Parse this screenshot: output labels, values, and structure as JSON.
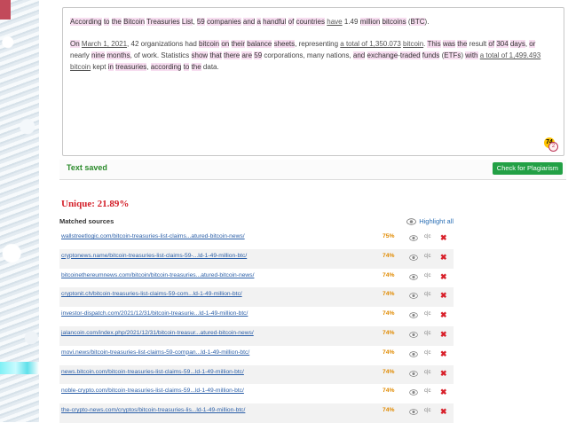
{
  "editor": {
    "paragraph1": [
      {
        "t": "According",
        "c": "hl"
      },
      {
        "t": " "
      },
      {
        "t": "to",
        "c": "hl"
      },
      {
        "t": " "
      },
      {
        "t": "the",
        "c": "hl"
      },
      {
        "t": " "
      },
      {
        "t": "Bitcoin",
        "c": "hl"
      },
      {
        "t": " "
      },
      {
        "t": "Treasuries",
        "c": "hl"
      },
      {
        "t": " "
      },
      {
        "t": "List",
        "c": "hl"
      },
      {
        "t": ", "
      },
      {
        "t": "59",
        "c": "hl"
      },
      {
        "t": " "
      },
      {
        "t": "companies",
        "c": "hl"
      },
      {
        "t": " "
      },
      {
        "t": "and",
        "c": "hl"
      },
      {
        "t": " "
      },
      {
        "t": "a",
        "c": "hl"
      },
      {
        "t": " "
      },
      {
        "t": "handful",
        "c": "hl"
      },
      {
        "t": " "
      },
      {
        "t": "of",
        "c": "hl"
      },
      {
        "t": " "
      },
      {
        "t": "countries",
        "c": "hl"
      },
      {
        "t": " "
      },
      {
        "t": "have",
        "c": "ul"
      },
      {
        "t": " 1.49 "
      },
      {
        "t": "million",
        "c": "hl"
      },
      {
        "t": " "
      },
      {
        "t": "bitcoins",
        "c": "hl"
      },
      {
        "t": " ("
      },
      {
        "t": "BTC",
        "c": "hl"
      },
      {
        "t": ")."
      }
    ],
    "paragraph2": [
      {
        "t": "On",
        "c": "hl"
      },
      {
        "t": " "
      },
      {
        "t": "March 1, 2021",
        "c": "ul"
      },
      {
        "t": ", 42 organizations had "
      },
      {
        "t": "bitcoin",
        "c": "hl"
      },
      {
        "t": " "
      },
      {
        "t": "on",
        "c": "hl"
      },
      {
        "t": " "
      },
      {
        "t": "their",
        "c": "hl"
      },
      {
        "t": " "
      },
      {
        "t": "balance",
        "c": "hl"
      },
      {
        "t": " "
      },
      {
        "t": "sheets",
        "c": "hl"
      },
      {
        "t": ", representing "
      },
      {
        "t": "a total of 1,350.073",
        "c": "ul"
      },
      {
        "t": " "
      },
      {
        "t": "bitcoin",
        "c": "ul"
      },
      {
        "t": ". "
      },
      {
        "t": "This",
        "c": "hl"
      },
      {
        "t": " "
      },
      {
        "t": "was",
        "c": "hl"
      },
      {
        "t": " "
      },
      {
        "t": "the",
        "c": "hl"
      },
      {
        "t": " result "
      },
      {
        "t": "of",
        "c": "hl"
      },
      {
        "t": " "
      },
      {
        "t": "304",
        "c": "hl"
      },
      {
        "t": " "
      },
      {
        "t": "days",
        "c": "hl"
      },
      {
        "t": ", "
      },
      {
        "t": "or",
        "c": "hl"
      },
      {
        "t": " nearly "
      },
      {
        "t": "nine",
        "c": "hl"
      },
      {
        "t": " "
      },
      {
        "t": "months",
        "c": "hl"
      },
      {
        "t": ", of work. Statistics "
      },
      {
        "t": "show",
        "c": "hl"
      },
      {
        "t": " "
      },
      {
        "t": "that",
        "c": "hl"
      },
      {
        "t": " "
      },
      {
        "t": "there",
        "c": "hl"
      },
      {
        "t": " "
      },
      {
        "t": "are",
        "c": "hl"
      },
      {
        "t": " "
      },
      {
        "t": "59",
        "c": "hl"
      },
      {
        "t": " corporations, many nations, "
      },
      {
        "t": "and",
        "c": "hl"
      },
      {
        "t": " "
      },
      {
        "t": "exchange",
        "c": "hl"
      },
      {
        "t": "-"
      },
      {
        "t": "traded",
        "c": "hl"
      },
      {
        "t": " "
      },
      {
        "t": "funds",
        "c": "hl"
      },
      {
        "t": " ("
      },
      {
        "t": "ETFs",
        "c": "hl"
      },
      {
        "t": ") "
      },
      {
        "t": "with",
        "c": "hl"
      },
      {
        "t": " "
      },
      {
        "t": "a total of 1,499.493",
        "c": "ul"
      },
      {
        "t": " "
      },
      {
        "t": "bitcoin",
        "c": "ul"
      },
      {
        "t": " kept "
      },
      {
        "t": "in",
        "c": "hl"
      },
      {
        "t": " "
      },
      {
        "t": "treasuries",
        "c": "hl"
      },
      {
        "t": ", "
      },
      {
        "t": "according",
        "c": "hl"
      },
      {
        "t": " "
      },
      {
        "t": "to",
        "c": "hl"
      },
      {
        "t": " "
      },
      {
        "t": "the",
        "c": "hl"
      },
      {
        "t": " data."
      }
    ],
    "badge_score": "74",
    "badge_sub": "2"
  },
  "status": {
    "saved_label": "Text saved",
    "check_button": "Check for Plagiarism"
  },
  "result": {
    "unique_label": "Unique: 21.89%"
  },
  "sources": {
    "title": "Matched sources",
    "highlight_all": "Highlight all",
    "compare_label": "c|c",
    "remove_glyph": "✖",
    "rows": [
      {
        "url": "wallstreetlogic.com/bitcoin-treasuries-list-claims...atured-bitcoin-news/",
        "pct": "75%"
      },
      {
        "url": "cryptonews.name/bitcoin-treasuries-list-claims-59-...ld-1-49-million-btc/",
        "pct": "74%"
      },
      {
        "url": "bitcoinethereumnews.com/bitcoin/bitcoin-treasuries...atured-bitcoin-news/",
        "pct": "74%"
      },
      {
        "url": "cryptonit.ch/bitcoin-treasuries-list-claims-59-com...ld-1-49-million-btc/",
        "pct": "74%"
      },
      {
        "url": "investor-dispatch.com/2021/12/31/bitcoin-treasurie...ld-1-49-million-btc/",
        "pct": "74%"
      },
      {
        "url": "jalancoin.com/index.php/2021/12/31/bitcoin-treasur...atured-bitcoin-news/",
        "pct": "74%"
      },
      {
        "url": "movi.news/bitcoin-treasuries-list-claims-59-compan...ld-1-49-million-btc/",
        "pct": "74%"
      },
      {
        "url": "news.bitcoin.com/bitcoin-treasuries-list-claims-59...ld-1-49-million-btc/",
        "pct": "74%"
      },
      {
        "url": "noble-crypto.com/bitcoin-treasuries-list-claims-59...ld-1-49-million-btc/",
        "pct": "74%"
      },
      {
        "url": "the-crypto-news.com/cryptos/bitcoin-treasuries-lis...ld-1-49-million-btc/",
        "pct": "74%"
      }
    ]
  },
  "colors": {
    "accent_green": "#22a045",
    "unique_red": "#d4202a",
    "percent_orange": "#e08a00",
    "link_blue": "#2b5fa8"
  }
}
